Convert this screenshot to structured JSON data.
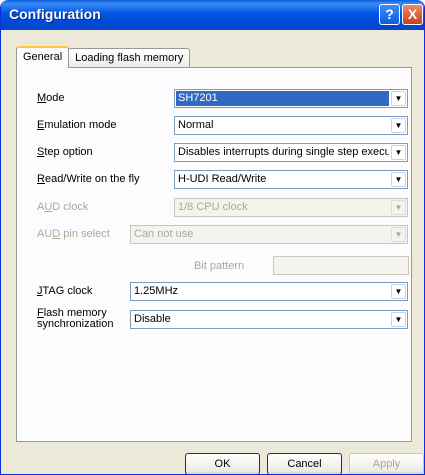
{
  "window": {
    "title": "Configuration",
    "help": "?",
    "close": "X"
  },
  "tabs": [
    {
      "label": "General"
    },
    {
      "label": "Loading flash memory"
    }
  ],
  "fields": {
    "mode": {
      "label_u": "M",
      "label_rest": "ode",
      "value": "SH7201"
    },
    "emulation": {
      "label_u": "E",
      "label_rest": "mulation mode",
      "value": "Normal"
    },
    "step": {
      "label_u": "S",
      "label_rest": "tep option",
      "value": "Disables interrupts during single step execution"
    },
    "rw": {
      "label_u": "R",
      "label_rest": "ead/Write on the fly",
      "value": "H-UDI Read/Write"
    },
    "aud_clock": {
      "label_a": "A",
      "label_u": "U",
      "label_rest": "D clock",
      "value": "1/8 CPU clock"
    },
    "aud_pin": {
      "label_a": "AU",
      "label_u": "D",
      "label_rest": " pin select",
      "value": "Can not use"
    },
    "bit_pattern": {
      "label": "Bit pattern"
    },
    "jtag": {
      "label_u": "J",
      "label_rest": "TAG clock",
      "value": "1.25MHz"
    },
    "flash": {
      "label_u": "F",
      "label_rest": "lash memory",
      "label_line2": "synchronization",
      "value": "Disable"
    }
  },
  "buttons": {
    "ok": "OK",
    "cancel": "Cancel",
    "apply": "Apply"
  },
  "arrow_glyph": "▼"
}
